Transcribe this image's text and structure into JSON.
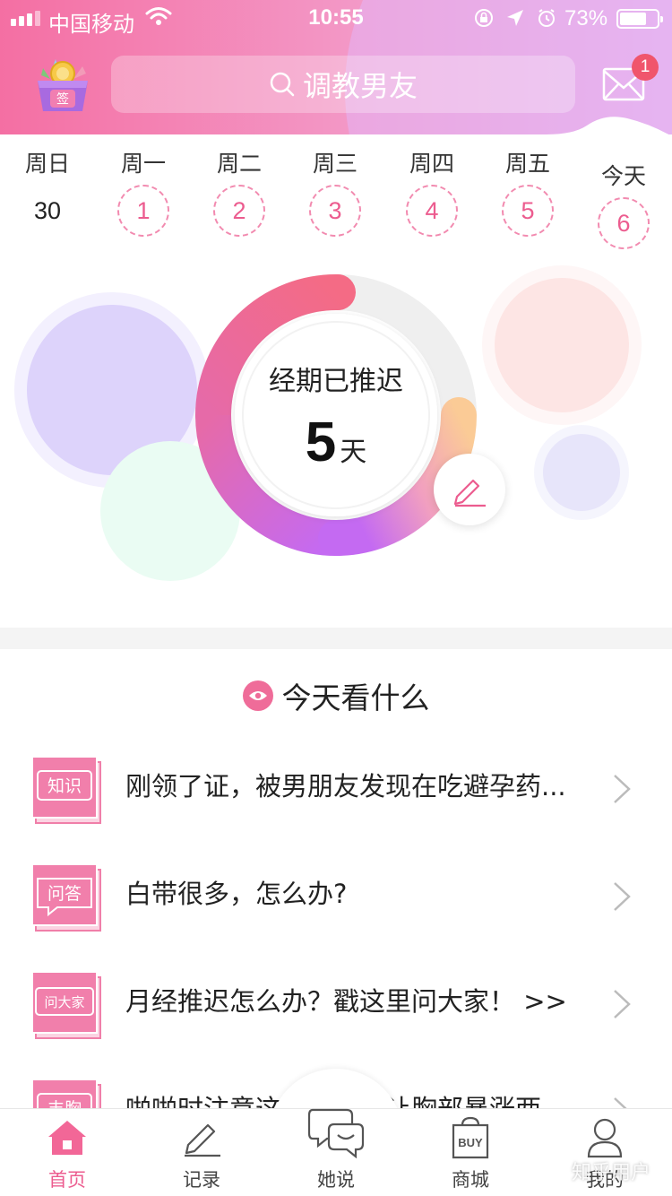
{
  "status_bar": {
    "carrier": "中国移动",
    "time": "10:55",
    "battery": "73%",
    "battery_level": 0.73
  },
  "header": {
    "sign_label": "签",
    "search_placeholder": "调教男友",
    "mail_badge": "1"
  },
  "week": [
    {
      "name": "周日",
      "num": "30"
    },
    {
      "name": "周一",
      "num": "1"
    },
    {
      "name": "周二",
      "num": "2"
    },
    {
      "name": "周三",
      "num": "3"
    },
    {
      "name": "周四",
      "num": "4"
    },
    {
      "name": "周五",
      "num": "5"
    },
    {
      "name": "今天",
      "num": "6"
    }
  ],
  "cycle": {
    "label": "经期已推迟",
    "value": "5",
    "unit": "天"
  },
  "today_section": {
    "title": "今天看什么",
    "items": [
      {
        "icon_text": "知识",
        "title": "刚领了证，被男朋友发现在吃避孕药..."
      },
      {
        "icon_text": "问答",
        "title": "白带很多，怎么办?"
      },
      {
        "icon_text": "问大家",
        "title": "月经推迟怎么办？戳这里问大家！ >>"
      },
      {
        "icon_text": "丰胸",
        "title": "啪啪时注意这三点，能让胸部暴涨两"
      }
    ]
  },
  "tabbar": {
    "tabs": [
      {
        "label": "首页",
        "icon": "home-icon",
        "buy_text": ""
      },
      {
        "label": "记录",
        "icon": "pencil-icon",
        "buy_text": ""
      },
      {
        "label": "她说",
        "icon": "chat-bubbles-icon",
        "buy_text": ""
      },
      {
        "label": "商城",
        "icon": "shopping-bag-icon",
        "buy_text": "BUY"
      },
      {
        "label": "我的",
        "icon": "person-icon",
        "buy_text": ""
      }
    ]
  },
  "watermark": "知乎用户",
  "colors": {
    "accent": "#ec5c8f",
    "header_start": "#f46fa3",
    "header_end": "#e8b4ec"
  }
}
